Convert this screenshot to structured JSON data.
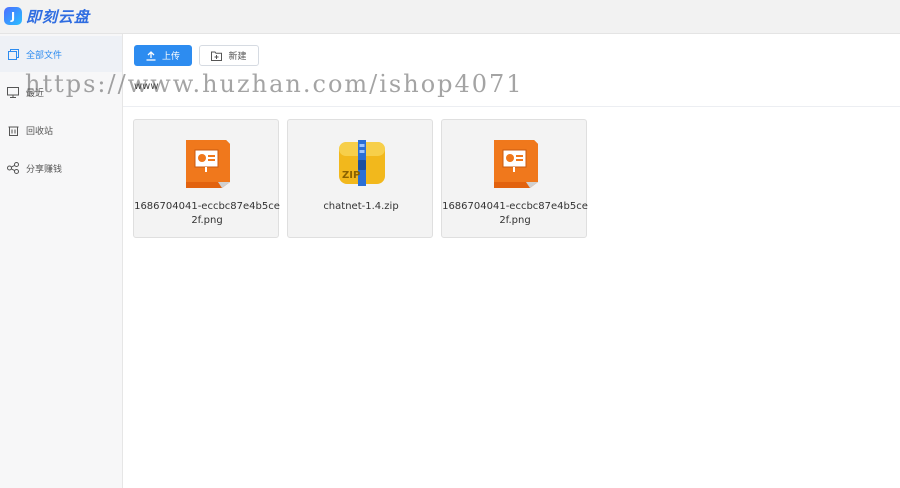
{
  "app": {
    "logo_mark": "J",
    "title": "即刻云盘"
  },
  "sidebar": {
    "items": [
      {
        "label": "全部文件",
        "icon": "files-icon",
        "active": true
      },
      {
        "label": "最近",
        "icon": "monitor-icon",
        "active": false
      },
      {
        "label": "回收站",
        "icon": "trash-icon",
        "active": false
      },
      {
        "label": "分享赚钱",
        "icon": "share-icon",
        "active": false
      }
    ]
  },
  "toolbar": {
    "upload_label": "上传",
    "new_label": "新建"
  },
  "breadcrumb": {
    "current": "www"
  },
  "files": [
    {
      "name": "1686704041-eccbc87e4b5ce2f.png",
      "icon": "ppt-file-icon"
    },
    {
      "name": "chatnet-1.4.zip",
      "icon": "zip-file-icon"
    },
    {
      "name": "1686704041-eccbc87e4b5ce2f.png",
      "icon": "ppt-file-icon"
    }
  ],
  "watermark": "https://www.huzhan.com/ishop4071",
  "colors": {
    "accent": "#2d8cf0",
    "sidebar_bg": "#f7f7f8",
    "card_bg": "#f3f3f3"
  }
}
